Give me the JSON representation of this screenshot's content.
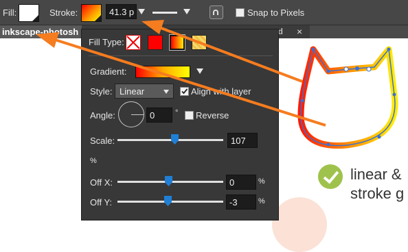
{
  "toolbar": {
    "fill_label": "Fill:",
    "stroke_label": "Stroke:",
    "stroke_width": "41.3 p",
    "snap_label": "Snap to Pixels",
    "snap_checked": false,
    "fill_color": "#ffffff",
    "stroke_gradient": [
      "#ff0000",
      "#ffff00"
    ]
  },
  "tabs": {
    "active_label": "inkscape-photosh",
    "inactive_tail": "sd",
    "close": "×"
  },
  "fill_panel": {
    "fill_type_label": "Fill Type:",
    "fill_types": [
      "none-icon",
      "solid-red-swatch",
      "gradient-swatch",
      "pattern-swatch"
    ],
    "gradient_label": "Gradient:",
    "style_label": "Style:",
    "style_value": "Linear",
    "align_label": "Align with layer",
    "align_checked": true,
    "angle_label": "Angle:",
    "angle_value": "0",
    "degree_symbol": "°",
    "reverse_label": "Reverse",
    "reverse_checked": false,
    "scale_label": "Scale:",
    "scale_value": "107",
    "percent": "%",
    "offx_label": "Off X:",
    "offx_value": "0",
    "offy_label": "Off Y:",
    "offy_value": "-3"
  },
  "canvas": {
    "line1": "linear &",
    "line2": "stroke g",
    "accent_orange": "#f57c1f",
    "check_green": "#9fc24c"
  }
}
